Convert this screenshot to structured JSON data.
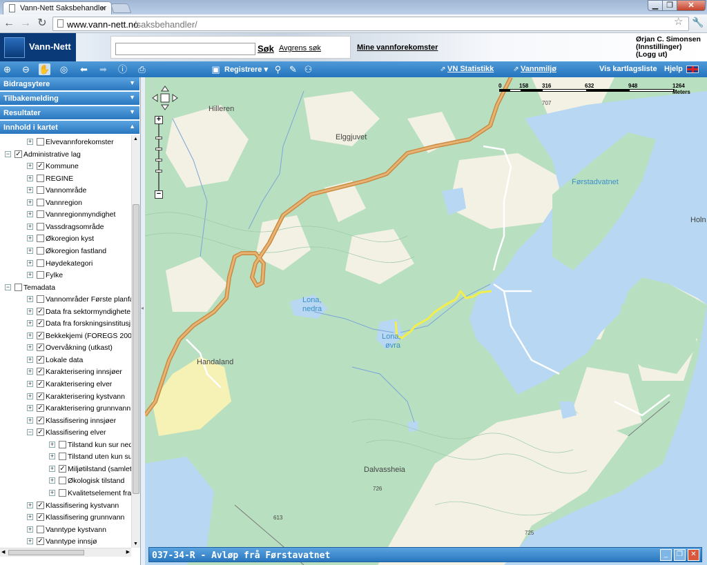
{
  "browser": {
    "tab_title": "Vann-Nett Saksbehandler",
    "tab_close": "×",
    "url_host": "www.vann-nett.no",
    "url_path": "/saksbehandler/",
    "window_min": "▁",
    "window_max": "❐",
    "window_close": "✕",
    "nav_back": "←",
    "nav_forward": "→",
    "nav_reload": "↻"
  },
  "header": {
    "logo_text": "Vann-Nett",
    "search_placeholder": "",
    "search_button": "Søk",
    "refine_link": "Avgrens søk",
    "my_waters_link": "Mine vannforekomster",
    "user_name": "Ørjan C. Simonsen",
    "settings_link": "(Innstillinger)",
    "logout_link": "(Logg ut)"
  },
  "toolbar": {
    "register_menu": "Registrere",
    "vn_statistics": "VN Statistikk",
    "water_env": "Vannmiljø",
    "layer_list": "Vis kartlagsliste",
    "help": "Hjelp"
  },
  "sidebar": {
    "panels": [
      {
        "label": "Bidragsytere",
        "chevron": "▼"
      },
      {
        "label": "Tilbakemelding",
        "chevron": "▼"
      },
      {
        "label": "Resultater",
        "chevron": "▼"
      },
      {
        "label": "Innhold i kartet",
        "chevron": "▲"
      }
    ],
    "tree": [
      {
        "label": "Elvevannforekomster",
        "level": 2,
        "checked": false,
        "expander": "+"
      },
      {
        "label": "Administrative lag",
        "level": 0,
        "checked": true,
        "expander": "−"
      },
      {
        "label": "Kommune",
        "level": 2,
        "checked": true,
        "expander": "+"
      },
      {
        "label": "REGINE",
        "level": 2,
        "checked": false,
        "expander": "+"
      },
      {
        "label": "Vannområde",
        "level": 2,
        "checked": false,
        "expander": "+"
      },
      {
        "label": "Vannregion",
        "level": 2,
        "checked": false,
        "expander": "+"
      },
      {
        "label": "Vannregionmyndighet",
        "level": 2,
        "checked": false,
        "expander": "+"
      },
      {
        "label": "Vassdragsområde",
        "level": 2,
        "checked": false,
        "expander": "+"
      },
      {
        "label": "Økoregion kyst",
        "level": 2,
        "checked": false,
        "expander": "+"
      },
      {
        "label": "Økoregion fastland",
        "level": 2,
        "checked": false,
        "expander": "+"
      },
      {
        "label": "Høydekategori",
        "level": 2,
        "checked": false,
        "expander": "+"
      },
      {
        "label": "Fylke",
        "level": 2,
        "checked": false,
        "expander": "+"
      },
      {
        "label": "Temadata",
        "level": 0,
        "checked": false,
        "expander": "−"
      },
      {
        "label": "Vannområder Første planfa",
        "level": 2,
        "checked": false,
        "expander": "+"
      },
      {
        "label": "Data fra sektormyndighete",
        "level": 2,
        "checked": true,
        "expander": "+"
      },
      {
        "label": "Data fra forskningsinstitusj",
        "level": 2,
        "checked": true,
        "expander": "+"
      },
      {
        "label": "Bekkekjemi (FOREGS 2008",
        "level": 2,
        "checked": true,
        "expander": "+"
      },
      {
        "label": "Overvåkning (utkast)",
        "level": 2,
        "checked": true,
        "expander": "+"
      },
      {
        "label": "Lokale data",
        "level": 2,
        "checked": true,
        "expander": "+"
      },
      {
        "label": "Karakterisering innsjøer",
        "level": 2,
        "checked": true,
        "expander": "+"
      },
      {
        "label": "Karakterisering elver",
        "level": 2,
        "checked": true,
        "expander": "+"
      },
      {
        "label": "Karakterisering kystvann",
        "level": 2,
        "checked": true,
        "expander": "+"
      },
      {
        "label": "Karakterisering grunnvann",
        "level": 2,
        "checked": true,
        "expander": "+"
      },
      {
        "label": "Klassifisering innsjøer",
        "level": 2,
        "checked": true,
        "expander": "+"
      },
      {
        "label": "Klassifisering elver",
        "level": 2,
        "checked": true,
        "expander": "−"
      },
      {
        "label": "Tilstand kun sur ned",
        "level": 4,
        "checked": false,
        "expander": "+"
      },
      {
        "label": "Tilstand uten kun su",
        "level": 4,
        "checked": false,
        "expander": "+"
      },
      {
        "label": "Miljøtilstand (samlet",
        "level": 4,
        "checked": true,
        "expander": "+"
      },
      {
        "label": "Økologisk tilstand",
        "level": 4,
        "checked": false,
        "expander": "+"
      },
      {
        "label": "Kvalitetselement fra",
        "level": 4,
        "checked": false,
        "expander": "+"
      },
      {
        "label": "Klassifisering kystvann",
        "level": 2,
        "checked": true,
        "expander": "+"
      },
      {
        "label": "Klassifisering grunnvann",
        "level": 2,
        "checked": true,
        "expander": "+"
      },
      {
        "label": "Vanntype kystvann",
        "level": 2,
        "checked": false,
        "expander": "+"
      },
      {
        "label": "Vanntype innsjø",
        "level": 2,
        "checked": true,
        "expander": "+"
      }
    ]
  },
  "map": {
    "scale_labels": [
      "0",
      "158",
      "316",
      "632",
      "948",
      "1264 Meters"
    ],
    "place_names": {
      "hilleren": "Hilleren",
      "elggjuvet": "Elggjuvet",
      "forstadvatnet": "Førstadvatnet",
      "holm": "Holn",
      "lona_nedra_1": "Lona,",
      "lona_nedra_2": "nedra",
      "lona_ovra_1": "Lona,",
      "lona_ovra_2": "øvra",
      "handaland": "Handaland",
      "dalvassheia": "Dalvassheia",
      "h707": "707",
      "h726": "726",
      "h725": "725",
      "h613": "613"
    },
    "colors": {
      "forest": "#b9dfc1",
      "open_land": "#f3f1e4",
      "water": "#b7d7f2",
      "road": "#d49a55",
      "selected_river": "#f3ee4a",
      "farmland": "#f6f1b4"
    },
    "zoom_in": "+",
    "zoom_out": "−"
  },
  "info_window": {
    "title": "037-34-R - Avløp frå Førstavatnet",
    "min": "_",
    "max": "❐",
    "close": "✕"
  }
}
